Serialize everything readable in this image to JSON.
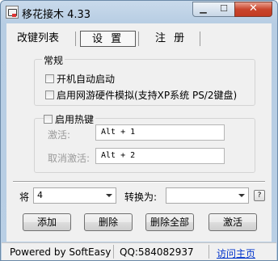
{
  "window": {
    "title": "移花接木 4.33",
    "min_icon": "minimize-icon",
    "max_icon": "maximize-icon",
    "close_icon": "close-icon"
  },
  "tabs": [
    {
      "label": "改键列表",
      "active": false
    },
    {
      "label": "设 置",
      "active": true
    },
    {
      "label": "注 册",
      "active": false
    }
  ],
  "settings": {
    "group_general": "常规",
    "autostart": {
      "label": "开机自动启动",
      "checked": false
    },
    "game_hw": {
      "label": "启用网游硬件模拟(支持XP系统 PS/2键盘)",
      "checked": false
    },
    "hotkey": {
      "label": "启用热键",
      "checked": false,
      "activate_label": "激活:",
      "activate_value": "Alt + 1",
      "deactivate_label": "取消激活:",
      "deactivate_value": "Alt + 2"
    }
  },
  "mapping": {
    "from_label": "将",
    "from_value": "4",
    "to_label": "转换为:",
    "to_value": "",
    "help_label": "?"
  },
  "buttons": {
    "add": "添加",
    "delete": "删除",
    "delete_all": "删除全部",
    "activate": "激活"
  },
  "status": {
    "powered": "Powered by SoftEasy",
    "qq": "QQ:584082937",
    "homepage": "访问主页"
  },
  "colors": {
    "titlebar": "#b9cfe5",
    "close_button": "#c9462d",
    "link": "#0033cc",
    "disabled_text": "#9a9a9a"
  }
}
